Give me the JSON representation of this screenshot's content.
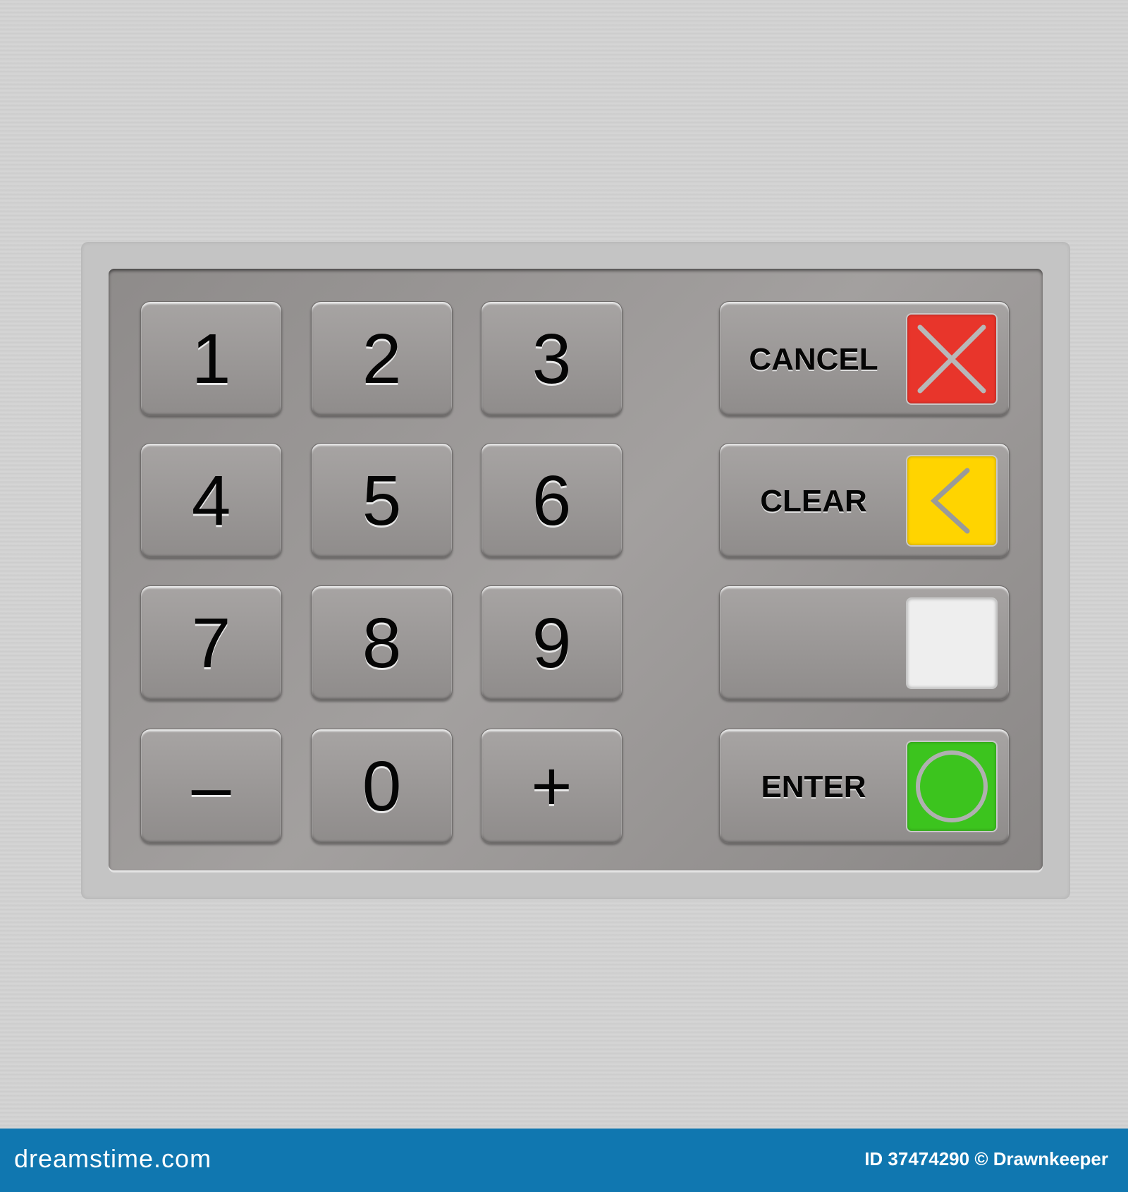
{
  "keypad": {
    "keys": [
      "1",
      "2",
      "3",
      "4",
      "5",
      "6",
      "7",
      "8",
      "9",
      "–",
      "0",
      "+"
    ],
    "function_keys": [
      {
        "label": "CANCEL",
        "color": "#e8352b",
        "icon": "x-icon"
      },
      {
        "label": "CLEAR",
        "color": "#ffd400",
        "icon": "chevron-left-icon"
      },
      {
        "label": "",
        "color": "#eeeeee",
        "icon": "blank"
      },
      {
        "label": "ENTER",
        "color": "#3cc41e",
        "icon": "circle-icon"
      }
    ]
  },
  "footer": {
    "logo": "dreamstime.com",
    "credit": "ID 37474290 © Drawnkeeper",
    "color": "#1077b0"
  }
}
